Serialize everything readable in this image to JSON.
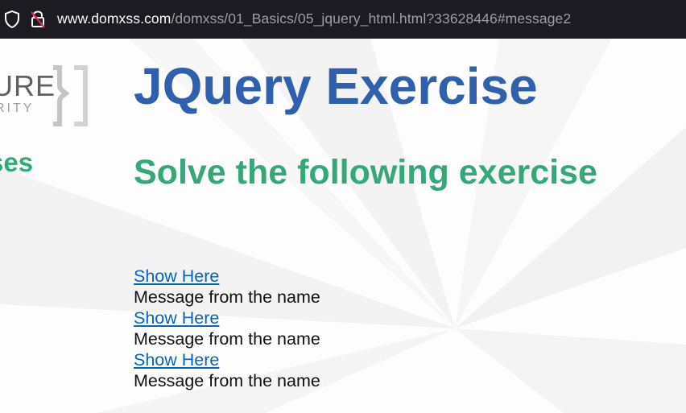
{
  "browser": {
    "url_host": "www.domxss.com",
    "url_path": "/domxss/01_Basics/05_jquery_html.html?33628446#message2",
    "icons": [
      "shield-icon",
      "insecure-lock-icon"
    ]
  },
  "sidebar": {
    "logo_text": "URE",
    "logo_subtext": "RITY",
    "heading": "ses"
  },
  "main": {
    "title": "JQuery Exercise",
    "subtitle": "Solve the following exercise",
    "items": [
      {
        "link": "Show Here",
        "message": "Message from the name"
      },
      {
        "link": "Show Here",
        "message": "Message from the name"
      },
      {
        "link": "Show Here",
        "message": "Message from the name"
      }
    ]
  },
  "colors": {
    "title": "#2f5fad",
    "subtitle": "#35a87a",
    "link": "#0563c1",
    "toolbar": "#1c1b22"
  }
}
